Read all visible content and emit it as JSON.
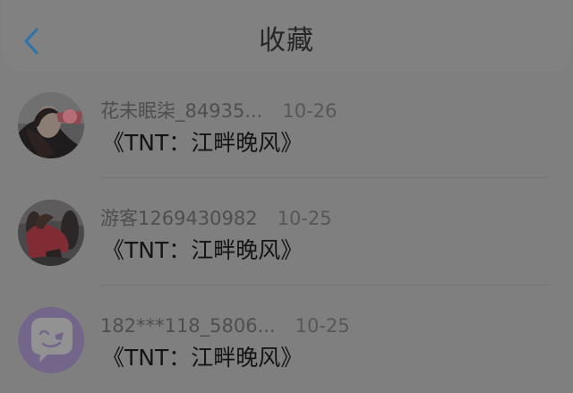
{
  "header": {
    "title": "收藏",
    "back_icon": "chevron-left-icon",
    "accent_color": "#2a74ad"
  },
  "favorites": [
    {
      "username": "花未眠柒_84935...",
      "date": "10-26",
      "title": "《TNT：江畔晚风》",
      "avatar": "photo-avatar"
    },
    {
      "username": "游客1269430982",
      "date": "10-25",
      "title": "《TNT：江畔晚风》",
      "avatar": "photo-avatar"
    },
    {
      "username": "182***118_5806...",
      "date": "10-25",
      "title": "《TNT：江畔晚风》",
      "avatar": "default-chat-avatar-icon"
    }
  ]
}
